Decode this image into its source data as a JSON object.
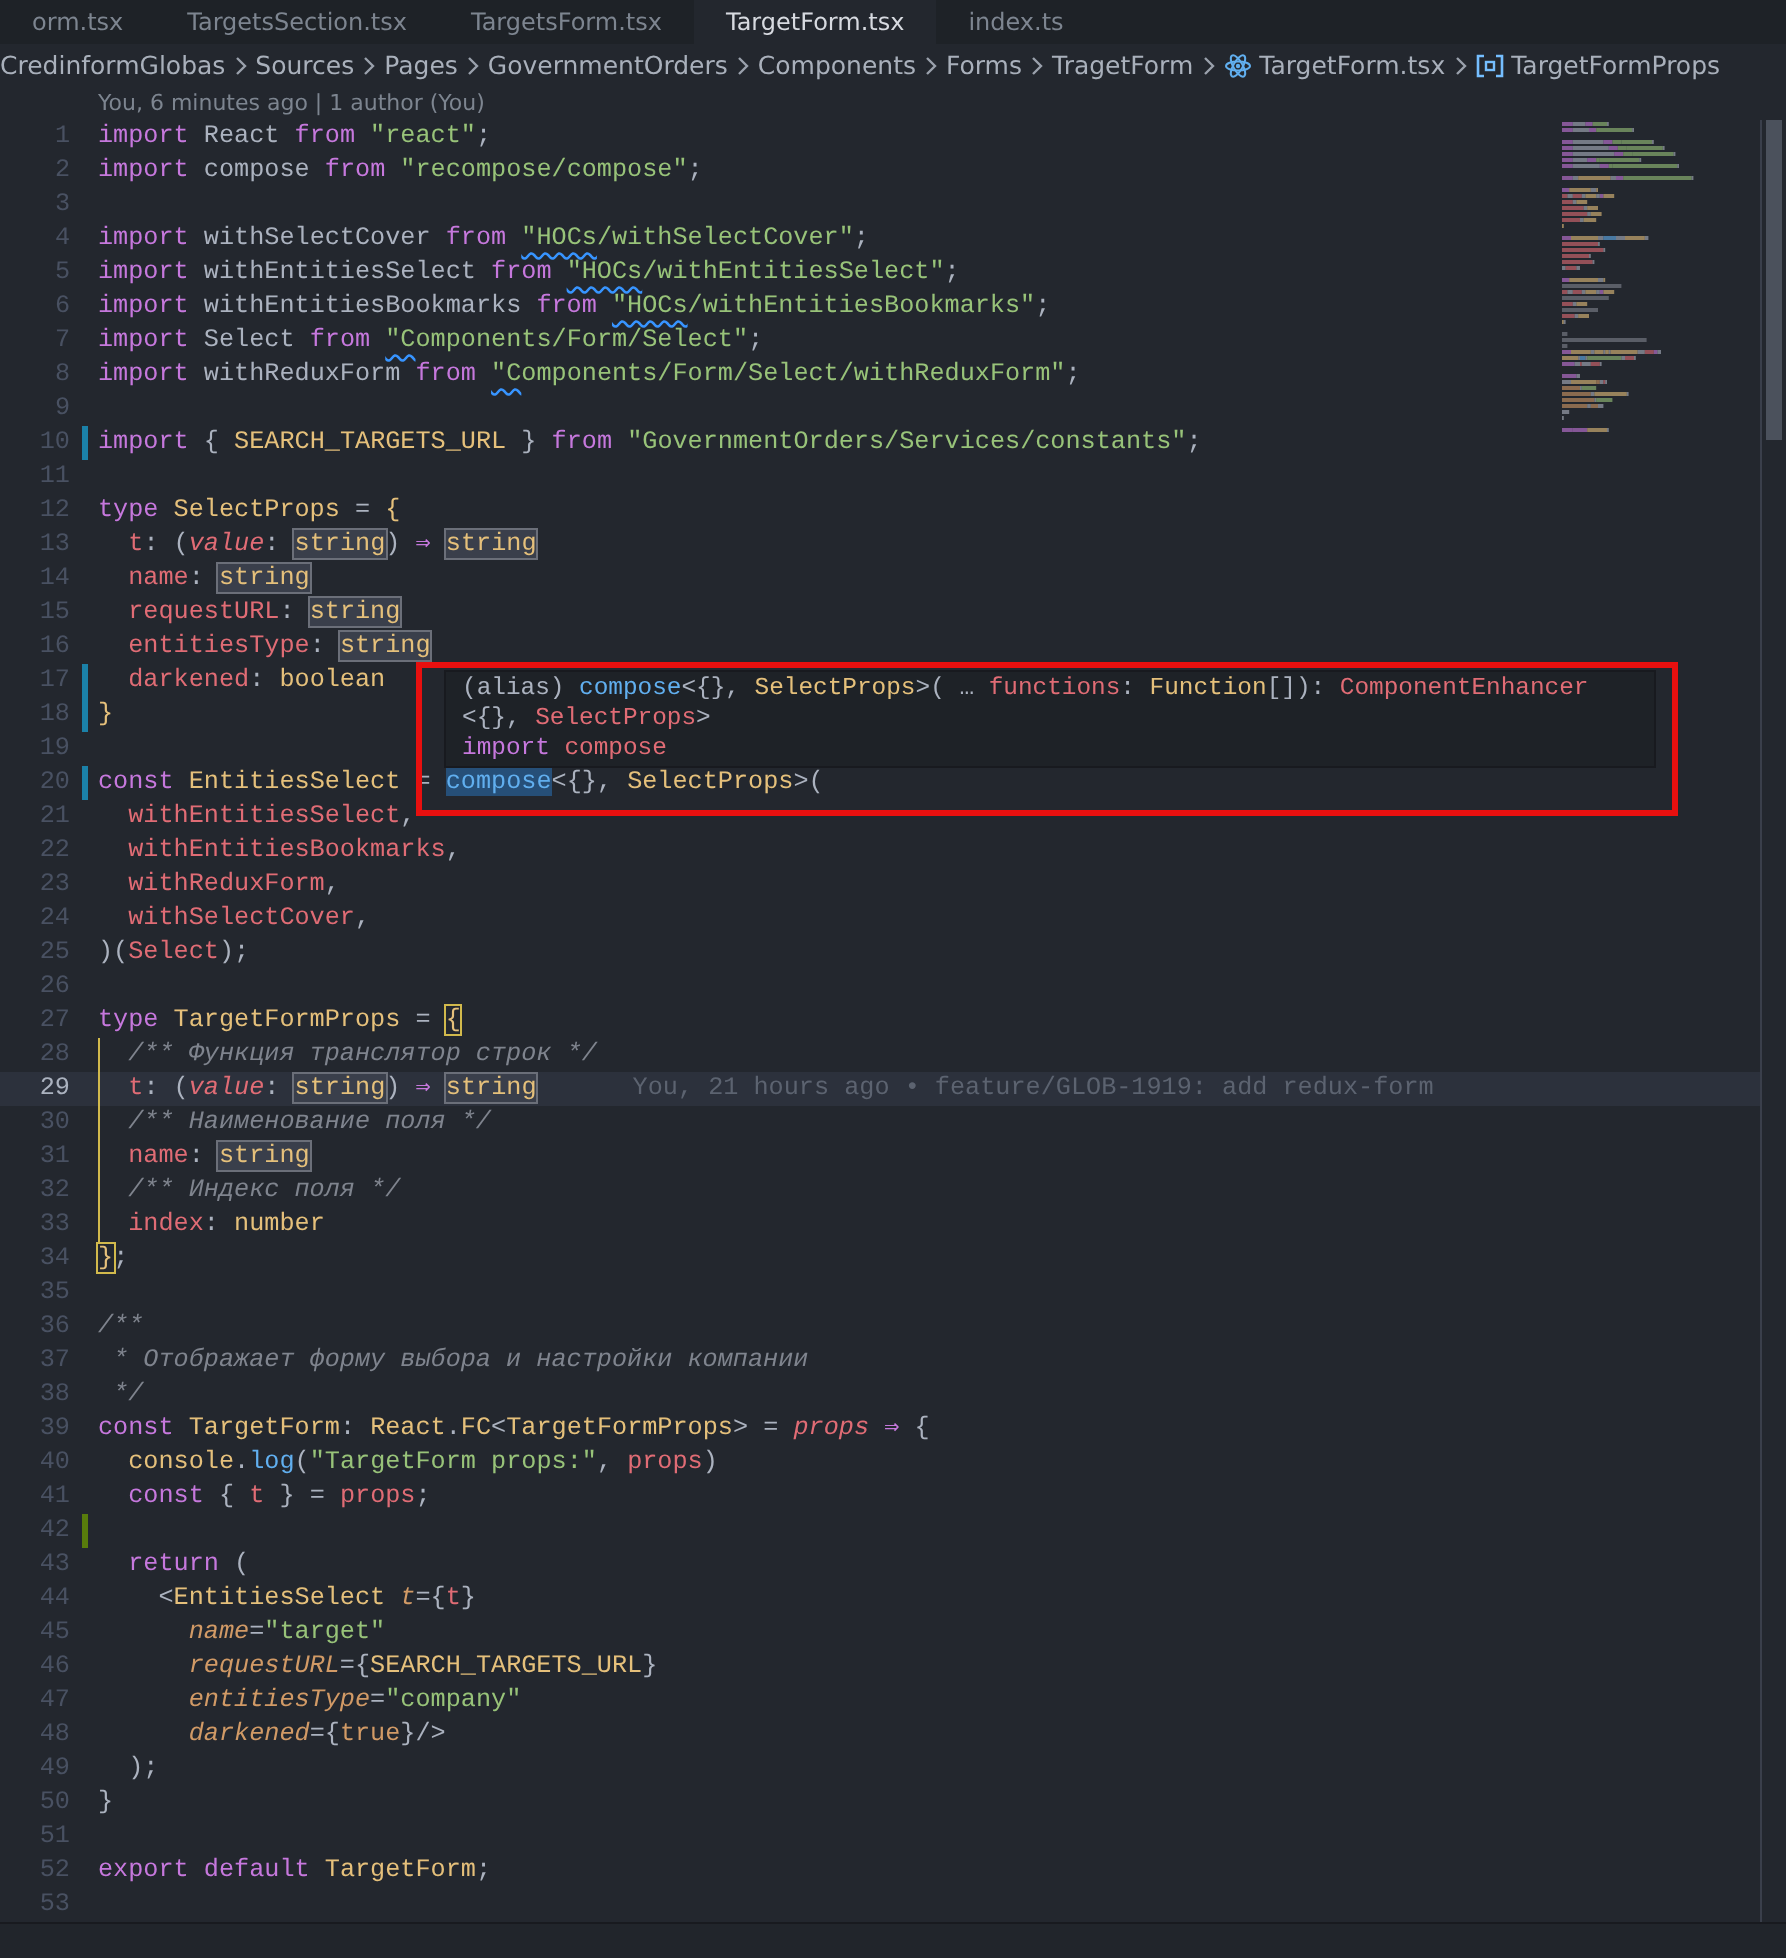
{
  "tabs": [
    {
      "label": "orm.tsx",
      "selected": false
    },
    {
      "label": "TargetsSection.tsx",
      "selected": false
    },
    {
      "label": "TargetsForm.tsx",
      "selected": false
    },
    {
      "label": "TargetForm.tsx",
      "selected": true
    },
    {
      "label": "index.ts",
      "selected": false
    }
  ],
  "breadcrumb": [
    {
      "label": "CredinformGlobas",
      "kind": "folder"
    },
    {
      "label": "Sources",
      "kind": "folder"
    },
    {
      "label": "Pages",
      "kind": "folder"
    },
    {
      "label": "GovernmentOrders",
      "kind": "folder"
    },
    {
      "label": "Components",
      "kind": "folder"
    },
    {
      "label": "Forms",
      "kind": "folder"
    },
    {
      "label": "TragetForm",
      "kind": "folder"
    },
    {
      "label": "TargetForm.tsx",
      "kind": "file"
    },
    {
      "label": "TargetFormProps",
      "kind": "symbol"
    }
  ],
  "codelens": "You, 6 minutes ago | 1 author (You)",
  "lines": [
    {
      "n": "1",
      "kind": "unchanged",
      "guide": false,
      "segments": [
        {
          "text": "import",
          "kind": "keyword"
        },
        {
          "text": " React ",
          "kind": "plain"
        },
        {
          "text": "from",
          "kind": "keyword"
        },
        {
          "text": " \"react\"",
          "kind": "string"
        },
        {
          "text": ";",
          "kind": "plain"
        }
      ]
    },
    {
      "n": "2",
      "kind": "unchanged",
      "guide": false,
      "segments": [
        {
          "text": "import",
          "kind": "keyword"
        },
        {
          "text": " compose ",
          "kind": "plain"
        },
        {
          "text": "from",
          "kind": "keyword"
        },
        {
          "text": " \"recompose/compose\"",
          "kind": "string"
        },
        {
          "text": ";",
          "kind": "plain"
        }
      ]
    },
    {
      "n": "3",
      "kind": "unchanged",
      "guide": false
    },
    {
      "n": "4",
      "kind": "unchanged",
      "guide": false,
      "segments": [
        {
          "text": "import",
          "kind": "keyword"
        },
        {
          "text": " withSelectCover ",
          "kind": "plain"
        },
        {
          "text": "from ",
          "kind": "keyword"
        },
        {
          "text": "\"HOCs",
          "kind": "squiggle"
        },
        {
          "text": "/withSelectCover\"",
          "kind": "string"
        },
        {
          "text": ";",
          "kind": "plain"
        }
      ]
    },
    {
      "n": "5",
      "kind": "unchanged",
      "guide": false,
      "segments": [
        {
          "text": "import",
          "kind": "keyword"
        },
        {
          "text": " withEntitiesSelect ",
          "kind": "plain"
        },
        {
          "text": "from ",
          "kind": "keyword"
        },
        {
          "text": "\"HOCs",
          "kind": "squiggle"
        },
        {
          "text": "/withEntitiesSelect\"",
          "kind": "string"
        },
        {
          "text": ";",
          "kind": "plain"
        }
      ]
    },
    {
      "n": "6",
      "kind": "unchanged",
      "guide": false,
      "segments": [
        {
          "text": "import",
          "kind": "keyword"
        },
        {
          "text": " withEntitiesBookmarks ",
          "kind": "plain"
        },
        {
          "text": "from ",
          "kind": "keyword"
        },
        {
          "text": "\"HOCs",
          "kind": "squiggle"
        },
        {
          "text": "/withEntitiesBookmarks\"",
          "kind": "string"
        },
        {
          "text": ";",
          "kind": "plain"
        }
      ]
    },
    {
      "n": "7",
      "kind": "unchanged",
      "guide": false,
      "segments": [
        {
          "text": "import",
          "kind": "keyword"
        },
        {
          "text": " Select ",
          "kind": "plain"
        },
        {
          "text": "from ",
          "kind": "keyword"
        },
        {
          "text": "\"C",
          "kind": "squiggle"
        },
        {
          "text": "omponents/Form/Select\"",
          "kind": "string"
        },
        {
          "text": ";",
          "kind": "plain"
        }
      ]
    },
    {
      "n": "8",
      "kind": "unchanged",
      "guide": false,
      "segments": [
        {
          "text": "import",
          "kind": "keyword"
        },
        {
          "text": " withReduxForm ",
          "kind": "plain"
        },
        {
          "text": "from ",
          "kind": "keyword"
        },
        {
          "text": "\"C",
          "kind": "squiggle"
        },
        {
          "text": "omponents/Form/Select/withReduxForm\"",
          "kind": "string"
        },
        {
          "text": ";",
          "kind": "plain"
        }
      ]
    },
    {
      "n": "9",
      "kind": "unchanged",
      "guide": false
    },
    {
      "n": "10",
      "kind": "modified",
      "guide": false,
      "segments": [
        {
          "text": "import",
          "kind": "keyword"
        },
        {
          "text": " { ",
          "kind": "plain"
        },
        {
          "text": "SEARCH_TARGETS_URL",
          "kind": "constant"
        },
        {
          "text": " } ",
          "kind": "plain"
        },
        {
          "text": "from",
          "kind": "keyword"
        },
        {
          "text": " \"GovernmentOrders/Services/constants\"",
          "kind": "string"
        },
        {
          "text": ";",
          "kind": "plain"
        }
      ]
    },
    {
      "n": "11",
      "kind": "unchanged",
      "guide": false
    },
    {
      "n": "12",
      "kind": "unchanged",
      "guide": false,
      "segments": [
        {
          "text": "type",
          "kind": "keyword"
        },
        {
          "text": " SelectProps",
          "kind": "type"
        },
        {
          "text": " = ",
          "kind": "plain"
        },
        {
          "text": "{",
          "kind": "type"
        }
      ]
    },
    {
      "n": "13",
      "kind": "unchanged",
      "guide": false,
      "segments": [
        {
          "text": "  t",
          "kind": "variable"
        },
        {
          "text": ": (",
          "kind": "plain"
        },
        {
          "text": "value",
          "kind": "parameter"
        },
        {
          "text": ": ",
          "kind": "plain"
        },
        {
          "text": "string",
          "kind": "boxed"
        },
        {
          "text": ") ",
          "kind": "plain"
        },
        {
          "text": "⇒ ",
          "kind": "keyword"
        },
        {
          "text": "string",
          "kind": "boxed"
        }
      ]
    },
    {
      "n": "14",
      "kind": "unchanged",
      "guide": false,
      "segments": [
        {
          "text": "  name",
          "kind": "variable"
        },
        {
          "text": ": ",
          "kind": "plain"
        },
        {
          "text": "string",
          "kind": "boxed"
        }
      ]
    },
    {
      "n": "15",
      "kind": "unchanged",
      "guide": false,
      "segments": [
        {
          "text": "  requestURL",
          "kind": "variable"
        },
        {
          "text": ": ",
          "kind": "plain"
        },
        {
          "text": "string",
          "kind": "boxed"
        }
      ]
    },
    {
      "n": "16",
      "kind": "unchanged",
      "guide": false,
      "segments": [
        {
          "text": "  entitiesType",
          "kind": "variable"
        },
        {
          "text": ": ",
          "kind": "plain"
        },
        {
          "text": "string",
          "kind": "boxed"
        }
      ]
    },
    {
      "n": "17",
      "kind": "modified",
      "guide": false,
      "segments": [
        {
          "text": "  darkened",
          "kind": "variable"
        },
        {
          "text": ": ",
          "kind": "plain"
        },
        {
          "text": "boolean",
          "kind": "type"
        }
      ]
    },
    {
      "n": "18",
      "kind": "modified",
      "guide": false,
      "segments": [
        {
          "text": "}",
          "kind": "type"
        }
      ]
    },
    {
      "n": "19",
      "kind": "unchanged",
      "guide": false
    },
    {
      "n": "20",
      "kind": "modified",
      "guide": false,
      "segments": [
        {
          "text": "const",
          "kind": "keyword"
        },
        {
          "text": " EntitiesSelect",
          "kind": "type"
        },
        {
          "text": " = ",
          "kind": "plain"
        },
        {
          "text": "compose",
          "kind": "selected"
        },
        {
          "text": "<{}, ",
          "kind": "plain"
        },
        {
          "text": "SelectProps",
          "kind": "type"
        },
        {
          "text": ">(",
          "kind": "plain"
        }
      ]
    },
    {
      "n": "21",
      "kind": "unchanged",
      "guide": false,
      "segments": [
        {
          "text": "  withEntitiesSelect",
          "kind": "variable"
        },
        {
          "text": ",",
          "kind": "plain"
        }
      ]
    },
    {
      "n": "22",
      "kind": "unchanged",
      "guide": false,
      "segments": [
        {
          "text": "  withEntitiesBookmarks",
          "kind": "variable"
        },
        {
          "text": ",",
          "kind": "plain"
        }
      ]
    },
    {
      "n": "23",
      "kind": "unchanged",
      "guide": false,
      "segments": [
        {
          "text": "  withReduxForm",
          "kind": "variable"
        },
        {
          "text": ",",
          "kind": "plain"
        }
      ]
    },
    {
      "n": "24",
      "kind": "unchanged",
      "guide": false,
      "segments": [
        {
          "text": "  withSelectCover",
          "kind": "variable"
        },
        {
          "text": ",",
          "kind": "plain"
        }
      ]
    },
    {
      "n": "25",
      "kind": "unchanged",
      "guide": false,
      "segments": [
        {
          "text": ")(",
          "kind": "plain"
        },
        {
          "text": "Select",
          "kind": "variable"
        },
        {
          "text": ");",
          "kind": "plain"
        }
      ]
    },
    {
      "n": "26",
      "kind": "unchanged",
      "guide": false
    },
    {
      "n": "27",
      "kind": "unchanged",
      "guide": false,
      "segments": [
        {
          "text": "type",
          "kind": "keyword"
        },
        {
          "text": " TargetFormProps",
          "kind": "type"
        },
        {
          "text": " = ",
          "kind": "plain"
        },
        {
          "text": "{",
          "kind": "bracket"
        }
      ]
    },
    {
      "n": "28",
      "kind": "unchanged",
      "guide": true,
      "segments": [
        {
          "text": "  /** Функция транслятор строк */",
          "kind": "comment"
        }
      ]
    },
    {
      "n": "29",
      "kind": "unchanged",
      "guide": true,
      "blame": "You, 21 hours ago • feature/GLOB-1919: add redux-form",
      "segments": [
        {
          "text": "  t",
          "kind": "variable"
        },
        {
          "text": ": (",
          "kind": "plain"
        },
        {
          "text": "value",
          "kind": "parameter"
        },
        {
          "text": ": ",
          "kind": "plain"
        },
        {
          "text": "string",
          "kind": "boxed"
        },
        {
          "text": ") ",
          "kind": "plain"
        },
        {
          "text": "⇒ ",
          "kind": "keyword"
        },
        {
          "text": "string",
          "kind": "boxed"
        }
      ]
    },
    {
      "n": "30",
      "kind": "unchanged",
      "guide": true,
      "segments": [
        {
          "text": "  /** Наименование поля */",
          "kind": "comment"
        }
      ]
    },
    {
      "n": "31",
      "kind": "unchanged",
      "guide": true,
      "segments": [
        {
          "text": "  name",
          "kind": "variable"
        },
        {
          "text": ": ",
          "kind": "plain"
        },
        {
          "text": "string",
          "kind": "boxed"
        }
      ]
    },
    {
      "n": "32",
      "kind": "unchanged",
      "guide": true,
      "segments": [
        {
          "text": "  /** Индекс поля */",
          "kind": "comment"
        }
      ]
    },
    {
      "n": "33",
      "kind": "unchanged",
      "guide": true,
      "segments": [
        {
          "text": "  index",
          "kind": "variable"
        },
        {
          "text": ": ",
          "kind": "plain"
        },
        {
          "text": "number",
          "kind": "type"
        }
      ]
    },
    {
      "n": "34",
      "kind": "unchanged",
      "guide": false,
      "segments": [
        {
          "text": "}",
          "kind": "bracket"
        },
        {
          "text": ";",
          "kind": "plain"
        }
      ]
    },
    {
      "n": "35",
      "kind": "unchanged",
      "guide": false
    },
    {
      "n": "36",
      "kind": "unchanged",
      "guide": false,
      "segments": [
        {
          "text": "/**",
          "kind": "comment"
        }
      ]
    },
    {
      "n": "37",
      "kind": "unchanged",
      "guide": false,
      "segments": [
        {
          "text": " * Отображает форму выбора и настройки компании",
          "kind": "comment"
        }
      ]
    },
    {
      "n": "38",
      "kind": "unchanged",
      "guide": false,
      "segments": [
        {
          "text": " */",
          "kind": "comment"
        }
      ]
    },
    {
      "n": "39",
      "kind": "unchanged",
      "guide": false,
      "segments": [
        {
          "text": "const",
          "kind": "keyword"
        },
        {
          "text": " TargetForm",
          "kind": "type"
        },
        {
          "text": ": ",
          "kind": "plain"
        },
        {
          "text": "React",
          "kind": "type"
        },
        {
          "text": ".",
          "kind": "plain"
        },
        {
          "text": "FC",
          "kind": "type"
        },
        {
          "text": "<",
          "kind": "plain"
        },
        {
          "text": "TargetFormProps",
          "kind": "type"
        },
        {
          "text": "> = ",
          "kind": "plain"
        },
        {
          "text": "props",
          "kind": "parameter"
        },
        {
          "text": " ⇒",
          "kind": "keyword"
        },
        {
          "text": " {",
          "kind": "plain"
        }
      ]
    },
    {
      "n": "40",
      "kind": "unchanged",
      "guide": false,
      "segments": [
        {
          "text": "  console",
          "kind": "type"
        },
        {
          "text": ".",
          "kind": "plain"
        },
        {
          "text": "log",
          "kind": "function"
        },
        {
          "text": "(",
          "kind": "plain"
        },
        {
          "text": "\"TargetForm props:\"",
          "kind": "string"
        },
        {
          "text": ", ",
          "kind": "plain"
        },
        {
          "text": "props",
          "kind": "variable"
        },
        {
          "text": ")",
          "kind": "plain"
        }
      ]
    },
    {
      "n": "41",
      "kind": "unchanged",
      "guide": false,
      "segments": [
        {
          "text": "  const",
          "kind": "keyword"
        },
        {
          "text": " { ",
          "kind": "plain"
        },
        {
          "text": "t",
          "kind": "variable"
        },
        {
          "text": " } = ",
          "kind": "plain"
        },
        {
          "text": "props",
          "kind": "variable"
        },
        {
          "text": ";",
          "kind": "plain"
        }
      ]
    },
    {
      "n": "42",
      "kind": "added",
      "guide": false
    },
    {
      "n": "43",
      "kind": "unchanged",
      "guide": false,
      "segments": [
        {
          "text": "  return",
          "kind": "keyword"
        },
        {
          "text": " (",
          "kind": "plain"
        }
      ]
    },
    {
      "n": "44",
      "kind": "unchanged",
      "guide": false,
      "segments": [
        {
          "text": "    <",
          "kind": "plain"
        },
        {
          "text": "EntitiesSelect",
          "kind": "type"
        },
        {
          "text": " t",
          "kind": "attribute"
        },
        {
          "text": "={",
          "kind": "plain"
        },
        {
          "text": "t",
          "kind": "variable"
        },
        {
          "text": "}",
          "kind": "plain"
        }
      ]
    },
    {
      "n": "45",
      "kind": "unchanged",
      "guide": false,
      "segments": [
        {
          "text": "      name",
          "kind": "attribute"
        },
        {
          "text": "=",
          "kind": "plain"
        },
        {
          "text": "\"target\"",
          "kind": "string"
        }
      ]
    },
    {
      "n": "46",
      "kind": "unchanged",
      "guide": false,
      "segments": [
        {
          "text": "      requestURL",
          "kind": "attribute"
        },
        {
          "text": "={",
          "kind": "plain"
        },
        {
          "text": "SEARCH_TARGETS_URL",
          "kind": "constant"
        },
        {
          "text": "}",
          "kind": "plain"
        }
      ]
    },
    {
      "n": "47",
      "kind": "unchanged",
      "guide": false,
      "segments": [
        {
          "text": "      entitiesType",
          "kind": "attribute"
        },
        {
          "text": "=",
          "kind": "plain"
        },
        {
          "text": "\"company\"",
          "kind": "string"
        }
      ]
    },
    {
      "n": "48",
      "kind": "unchanged",
      "guide": false,
      "segments": [
        {
          "text": "      darkened",
          "kind": "attribute"
        },
        {
          "text": "={",
          "kind": "plain"
        },
        {
          "text": "true",
          "kind": "literal"
        },
        {
          "text": "}/>",
          "kind": "plain"
        }
      ]
    },
    {
      "n": "49",
      "kind": "unchanged",
      "guide": false,
      "segments": [
        {
          "text": "  );",
          "kind": "plain"
        }
      ]
    },
    {
      "n": "50",
      "kind": "unchanged",
      "guide": false,
      "segments": [
        {
          "text": "}",
          "kind": "plain"
        }
      ]
    },
    {
      "n": "51",
      "kind": "unchanged",
      "guide": false
    },
    {
      "n": "52",
      "kind": "unchanged",
      "guide": false,
      "segments": [
        {
          "text": "export",
          "kind": "keyword"
        },
        {
          "text": " default",
          "kind": "keyword"
        },
        {
          "text": " TargetForm",
          "kind": "type"
        },
        {
          "text": ";",
          "kind": "plain"
        }
      ]
    },
    {
      "n": "53",
      "kind": "unchanged",
      "guide": false
    }
  ],
  "hover": {
    "lines": [
      {
        "segments": [
          {
            "text": "(alias) ",
            "kind": "plain"
          },
          {
            "text": "compose",
            "kind": "function"
          },
          {
            "text": "<{}, ",
            "kind": "plain"
          },
          {
            "text": "SelectProps",
            "kind": "type"
          },
          {
            "text": ">( … ",
            "kind": "plain"
          },
          {
            "text": "functions",
            "kind": "variable"
          },
          {
            "text": ": ",
            "kind": "plain"
          },
          {
            "text": "Function",
            "kind": "type"
          },
          {
            "text": "[]): ",
            "kind": "plain"
          },
          {
            "text": "ComponentEnhancer",
            "kind": "variable"
          }
        ]
      },
      {
        "segments": [
          {
            "text": "<{}, ",
            "kind": "plain"
          },
          {
            "text": "SelectProps",
            "kind": "variable"
          },
          {
            "text": ">",
            "kind": "plain"
          }
        ]
      },
      {
        "segments": [
          {
            "text": "import",
            "kind": "keyword"
          },
          {
            "text": " compose",
            "kind": "variable"
          }
        ]
      }
    ]
  }
}
